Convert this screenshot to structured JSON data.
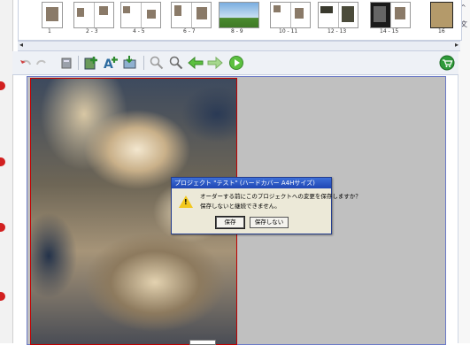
{
  "filmstrip": {
    "labels": [
      "1",
      "2 - 3",
      "4 - 5",
      "6 - 7",
      "8 - 9",
      "10 - 11",
      "12 - 13",
      "14 - 15",
      "16"
    ]
  },
  "toolbar": {
    "buttons": [
      "undo-icon",
      "redo-icon",
      "trash-icon",
      "add-page-icon",
      "add-text-icon",
      "save-icon",
      "zoom-out-icon",
      "zoom-in-icon",
      "back-arrow-icon",
      "forward-arrow-icon",
      "play-icon",
      "cart-icon"
    ]
  },
  "dialog": {
    "title": "プロジェクト \"テスト\" (ハードカバー  A4Hサイズ)",
    "message_line1": "オーダーする前にこのプロジェクトへの変更を保存しますか？",
    "message_line2": "保存しないと継続できません。",
    "save_label": "保存",
    "dont_save_label": "保存しない"
  },
  "colors": {
    "frame_red": "#c00000",
    "canvas_gray": "#c0c0c0",
    "dialog_title_blue": "#1f46b3",
    "arrow_green": "#5cc040"
  }
}
